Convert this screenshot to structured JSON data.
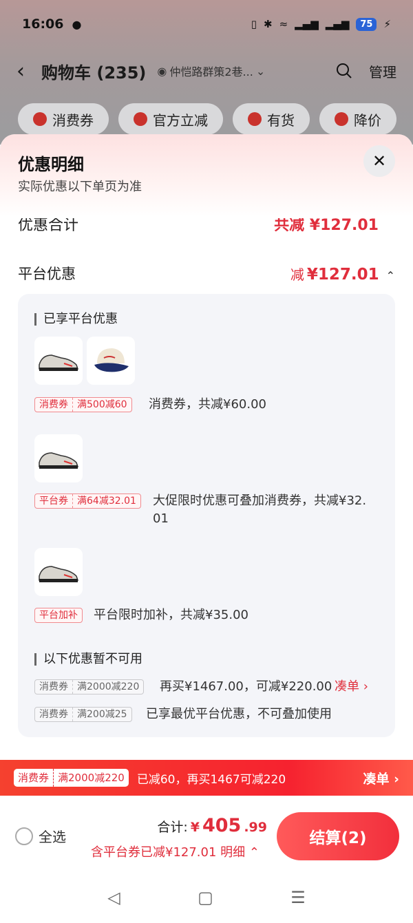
{
  "status_bar": {
    "time": "16:06",
    "battery": "75",
    "icons": [
      "wechat-icon",
      "vibrate-icon",
      "bluetooth-icon",
      "wifi-icon",
      "5g-signal-icon",
      "5g-signal-icon",
      "charging-icon"
    ]
  },
  "header": {
    "title": "购物车 (235)",
    "address": "仲恺路群策2巷...",
    "manage_label": "管理"
  },
  "filters": [
    "消费券",
    "官方立减",
    "有货",
    "降价"
  ],
  "sheet": {
    "title": "优惠明细",
    "subtitle": "实际优惠以下单页为准",
    "total_label": "优惠合计",
    "total_value": "共减 ¥127.01",
    "platform_label": "平台优惠",
    "platform_prefix": "减",
    "platform_amount": "¥127.01",
    "enjoyed_title": "已享平台优惠",
    "enjoyed": [
      {
        "tag_type": "消费券",
        "tag_rule": "满500减60",
        "desc": "消费券，共减¥60.00",
        "products": [
          "sneaker",
          "cap"
        ]
      },
      {
        "tag_type": "平台券",
        "tag_rule": "满64减32.01",
        "desc_line1": "大促限时优惠可叠加消费券，共减¥32.",
        "desc_line2": "01",
        "products": [
          "sneaker"
        ]
      },
      {
        "tag_type": "平台加补",
        "desc": "平台限时加补，共减¥35.00",
        "products": [
          "sneaker"
        ]
      }
    ],
    "unavailable_title": "以下优惠暂不可用",
    "unavailable": [
      {
        "tag_type": "消费券",
        "tag_rule": "满2000减220",
        "desc": "再买¥1467.00，可减¥220.00",
        "link": "凑单"
      },
      {
        "tag_type": "消费券",
        "tag_rule": "满200减25",
        "desc": "已享最优平台优惠，不可叠加使用"
      }
    ]
  },
  "promo_banner": {
    "tag_type": "消费券",
    "tag_rule": "满2000减220",
    "text": "已减60，再买1467可减220",
    "link": "凑单"
  },
  "bottom_bar": {
    "select_all": "全选",
    "total_label": "合计:",
    "currency": "¥",
    "total_int": "405",
    "total_dec": ".99",
    "discount_text": "含平台券已减¥127.01",
    "detail_link": "明细",
    "checkout_label": "结算(2)"
  },
  "colors": {
    "accent_red": "#e02e3c",
    "banner_red": "#f6222f",
    "checkout_red": "#f22f3c"
  }
}
